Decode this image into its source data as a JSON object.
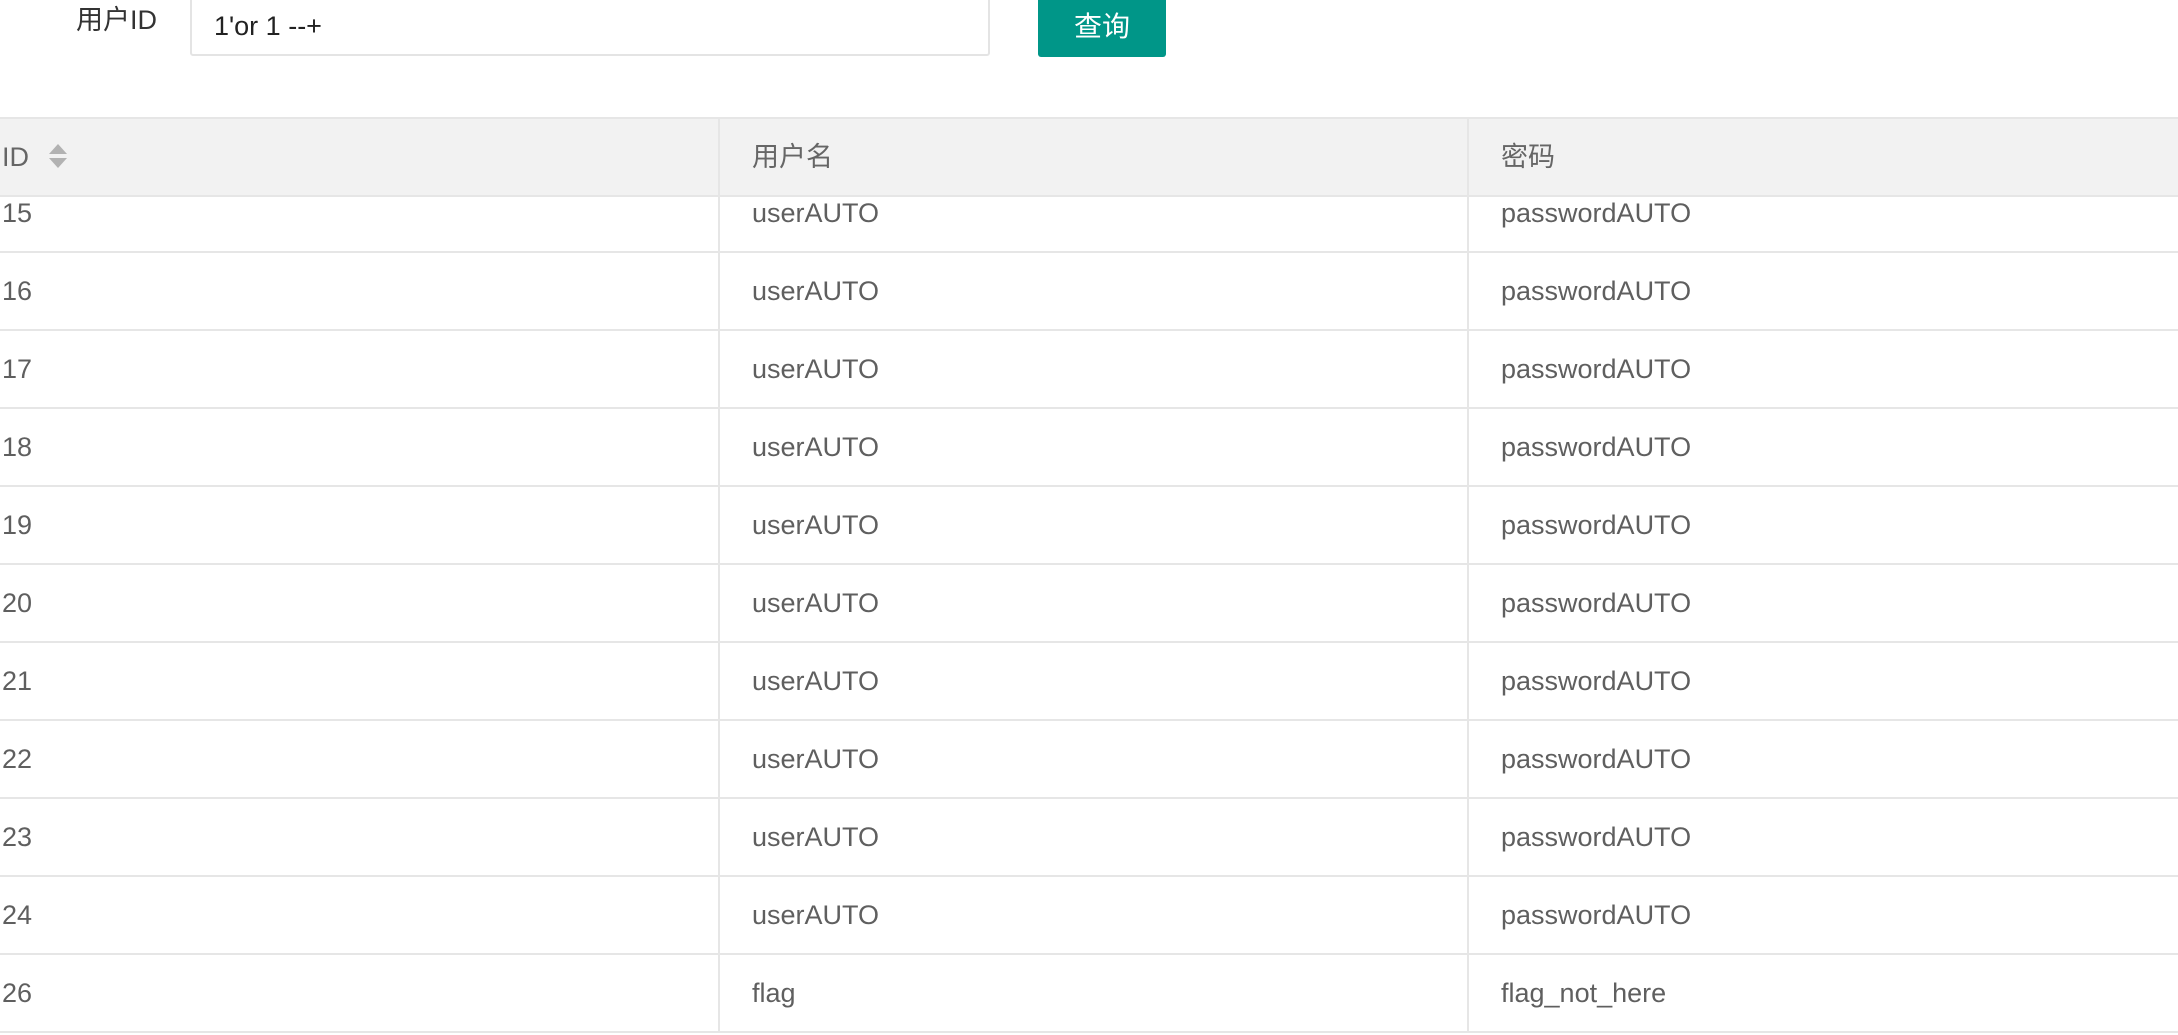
{
  "search": {
    "label": "用户ID",
    "value": "1'or 1 --+",
    "button_label": "查询"
  },
  "table": {
    "columns": [
      "ID",
      "用户名",
      "密码"
    ],
    "rows": [
      {
        "id": "15",
        "username": "userAUTO",
        "password": "passwordAUTO"
      },
      {
        "id": "16",
        "username": "userAUTO",
        "password": "passwordAUTO"
      },
      {
        "id": "17",
        "username": "userAUTO",
        "password": "passwordAUTO"
      },
      {
        "id": "18",
        "username": "userAUTO",
        "password": "passwordAUTO"
      },
      {
        "id": "19",
        "username": "userAUTO",
        "password": "passwordAUTO"
      },
      {
        "id": "20",
        "username": "userAUTO",
        "password": "passwordAUTO"
      },
      {
        "id": "21",
        "username": "userAUTO",
        "password": "passwordAUTO"
      },
      {
        "id": "22",
        "username": "userAUTO",
        "password": "passwordAUTO"
      },
      {
        "id": "23",
        "username": "userAUTO",
        "password": "passwordAUTO"
      },
      {
        "id": "24",
        "username": "userAUTO",
        "password": "passwordAUTO"
      },
      {
        "id": "26",
        "username": "flag",
        "password": "flag_not_here"
      }
    ]
  },
  "colors": {
    "button": "#009688",
    "header_bg": "#f2f2f2",
    "border": "#e6e6e6"
  },
  "icons": {
    "sort": "sort-icon"
  }
}
